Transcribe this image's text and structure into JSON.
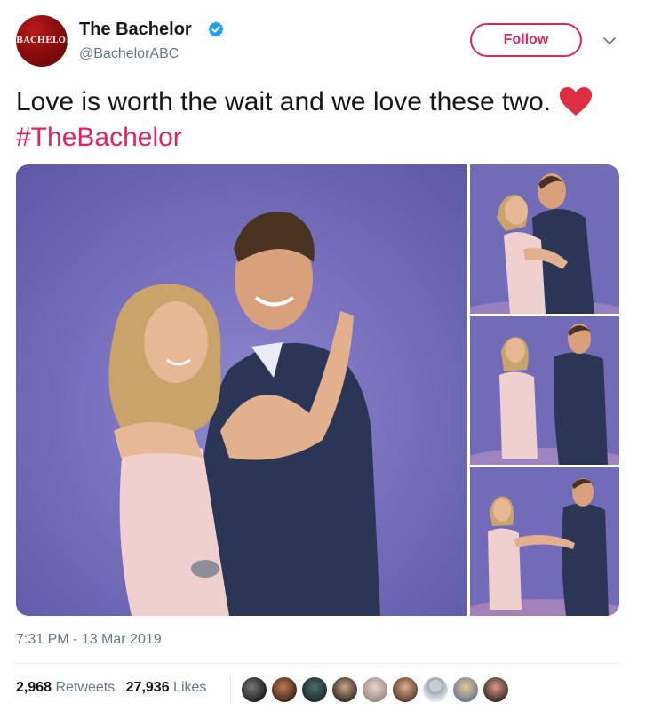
{
  "user": {
    "display_name": "The Bachelor",
    "handle": "@BachelorABC",
    "avatar_text": "BACHELOR",
    "verified": true
  },
  "follow_label": "Follow",
  "tweet": {
    "text_part1": "Love is worth the wait and we love these two.",
    "heart_icon": "red-heart-emoji",
    "hashtag": "#TheBachelor",
    "timestamp": "7:31 PM - 13 Mar 2019"
  },
  "stats": {
    "retweets_count": "2,968",
    "retweets_label": "Retweets",
    "likes_count": "27,936",
    "likes_label": "Likes"
  },
  "colors": {
    "accent": "#e0245e",
    "verified": "#1da1f2",
    "muted_text": "#657786",
    "photo_backdrop": "#6f68b4"
  },
  "icons": {
    "verified": "verified-badge-icon",
    "more": "chevron-down-icon"
  }
}
